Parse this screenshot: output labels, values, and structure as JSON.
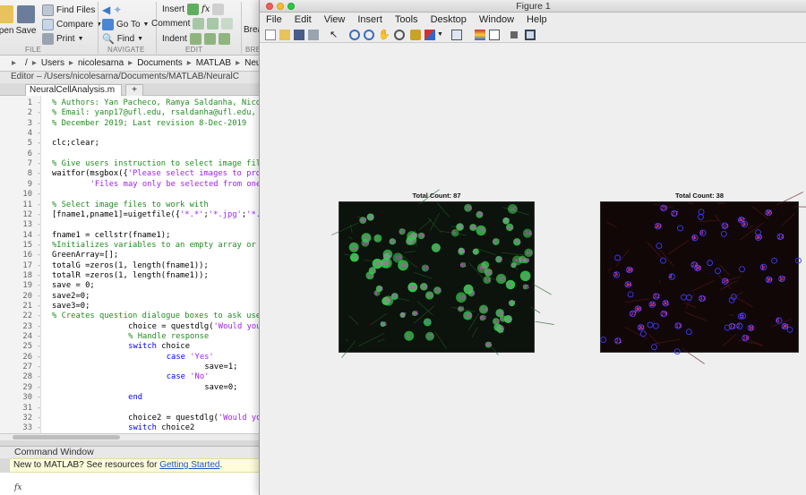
{
  "toolstrip": {
    "open_label": "Open",
    "save_label": "Save",
    "find_files_label": "Find Files",
    "compare_label": "Compare",
    "print_label": "Print",
    "go_to_label": "Go To",
    "find_label": "Find",
    "insert_label": "Insert",
    "comment_label": "Comment",
    "indent_label": "Indent",
    "breakpoints_label": "Brea",
    "sections": [
      "FILE",
      "NAVIGATE",
      "EDIT",
      "BREAK"
    ]
  },
  "address": {
    "segments": [
      "/",
      "Users",
      "nicolesarna",
      "Documents",
      "MATLAB",
      "NeuralC"
    ]
  },
  "editor": {
    "title": "Editor – /Users/nicolesarna/Documents/MATLAB/NeuralC",
    "active_tab": "NeuralCellAnalysis.m",
    "add_tab": "+",
    "lines": [
      {
        "n": "1",
        "d": "-",
        "segs": [
          {
            "t": "    % Authors: Yan Pacheco, Ramya Saldanha, Nico",
            "c": "com"
          }
        ]
      },
      {
        "n": "2",
        "d": "-",
        "segs": [
          {
            "t": "    % Email: yanp17@ufl.edu, rsaldanha@ufl.edu,",
            "c": "com"
          }
        ]
      },
      {
        "n": "3",
        "d": "-",
        "segs": [
          {
            "t": "    % December 2019; Last revision 8-Dec-2019",
            "c": "com"
          }
        ]
      },
      {
        "n": "4",
        "d": "-",
        "segs": []
      },
      {
        "n": "5",
        "d": "-",
        "segs": [
          {
            "t": "    clc;clear;",
            "c": ""
          }
        ]
      },
      {
        "n": "6",
        "d": "-",
        "segs": []
      },
      {
        "n": "7",
        "d": "-",
        "segs": [
          {
            "t": "    % Give users instruction to select image fil",
            "c": "com"
          }
        ]
      },
      {
        "n": "8",
        "d": "-",
        "segs": [
          {
            "t": "    waitfor(msgbox({",
            "c": ""
          },
          {
            "t": "'Please select images to pro",
            "c": "str"
          }
        ]
      },
      {
        "n": "9",
        "d": "-",
        "segs": [
          {
            "t": "        ",
            "c": ""
          },
          {
            "t": "'Files may only be selected from one dir",
            "c": "str"
          }
        ]
      },
      {
        "n": "10",
        "d": "-",
        "segs": []
      },
      {
        "n": "11",
        "d": "-",
        "segs": [
          {
            "t": "    % Select image files to work with",
            "c": "com"
          }
        ]
      },
      {
        "n": "12",
        "d": "-",
        "segs": [
          {
            "t": "    [fname1,pname1]=uigetfile({",
            "c": ""
          },
          {
            "t": "'*.*'",
            "c": "str"
          },
          {
            "t": ";",
            "c": ""
          },
          {
            "t": "'*.jpg'",
            "c": "str"
          },
          {
            "t": ";",
            "c": ""
          },
          {
            "t": "'*.",
            "c": "str"
          }
        ]
      },
      {
        "n": "13",
        "d": "-",
        "segs": []
      },
      {
        "n": "14",
        "d": "-",
        "segs": [
          {
            "t": "    fname1 = cellstr(fname1);",
            "c": ""
          }
        ]
      },
      {
        "n": "15",
        "d": "-",
        "segs": [
          {
            "t": "    %Initializes variables to an empty array or",
            "c": "com"
          }
        ]
      },
      {
        "n": "16",
        "d": "-",
        "segs": [
          {
            "t": "    GreenArray=[];",
            "c": ""
          }
        ]
      },
      {
        "n": "17",
        "d": "-",
        "segs": [
          {
            "t": "    totalG =zeros(1, length(fname1));",
            "c": ""
          }
        ]
      },
      {
        "n": "18",
        "d": "-",
        "segs": [
          {
            "t": "    totalR =zeros(1, length(fname1));",
            "c": ""
          }
        ]
      },
      {
        "n": "19",
        "d": "-",
        "segs": [
          {
            "t": "    save = 0;",
            "c": ""
          }
        ]
      },
      {
        "n": "20",
        "d": "-",
        "segs": [
          {
            "t": "    save2=0;",
            "c": ""
          }
        ]
      },
      {
        "n": "21",
        "d": "-",
        "segs": [
          {
            "t": "    save3=0;",
            "c": ""
          }
        ]
      },
      {
        "n": "22",
        "d": "-",
        "segs": [
          {
            "t": "    % Creates question dialogue boxes to ask use",
            "c": "com"
          }
        ]
      },
      {
        "n": "23",
        "d": "-",
        "segs": [
          {
            "t": "            choice = questdlg(",
            "c": ""
          },
          {
            "t": "'Would you like to",
            "c": "str"
          }
        ]
      },
      {
        "n": "24",
        "d": "-",
        "segs": [
          {
            "t": "            % Handle response",
            "c": "com"
          }
        ]
      },
      {
        "n": "25",
        "d": "-",
        "segs": [
          {
            "t": "            ",
            "c": ""
          },
          {
            "t": "switch",
            "c": "key"
          },
          {
            "t": " choice",
            "c": ""
          }
        ]
      },
      {
        "n": "26",
        "d": "-",
        "segs": [
          {
            "t": "                ",
            "c": ""
          },
          {
            "t": "case",
            "c": "key"
          },
          {
            "t": " ",
            "c": ""
          },
          {
            "t": "'Yes'",
            "c": "str"
          }
        ]
      },
      {
        "n": "27",
        "d": "-",
        "segs": [
          {
            "t": "                    save=1;",
            "c": ""
          }
        ]
      },
      {
        "n": "28",
        "d": "-",
        "segs": [
          {
            "t": "                ",
            "c": ""
          },
          {
            "t": "case",
            "c": "key"
          },
          {
            "t": " ",
            "c": ""
          },
          {
            "t": "'No'",
            "c": "str"
          }
        ]
      },
      {
        "n": "29",
        "d": "-",
        "segs": [
          {
            "t": "                    save=0;",
            "c": ""
          }
        ]
      },
      {
        "n": "30",
        "d": "-",
        "segs": [
          {
            "t": "            ",
            "c": ""
          },
          {
            "t": "end",
            "c": "key"
          }
        ]
      },
      {
        "n": "31",
        "d": "-",
        "segs": []
      },
      {
        "n": "32",
        "d": "-",
        "segs": [
          {
            "t": "            choice2 = questdlg(",
            "c": ""
          },
          {
            "t": "'Would you like t",
            "c": "str"
          }
        ]
      },
      {
        "n": "33",
        "d": "-",
        "segs": [
          {
            "t": "            ",
            "c": ""
          },
          {
            "t": "switch",
            "c": "key"
          },
          {
            "t": " choice2",
            "c": ""
          }
        ]
      }
    ]
  },
  "command_window": {
    "header": "Command Window",
    "banner_text": "New to MATLAB? See resources for ",
    "banner_link": "Getting Started",
    "banner_end": ".",
    "prompt_icon": "fx"
  },
  "figure": {
    "window_title": "Figure 1",
    "menus": [
      "File",
      "Edit",
      "View",
      "Insert",
      "Tools",
      "Desktop",
      "Window",
      "Help"
    ],
    "toolbar_icons": [
      "new-figure-icon",
      "open-file-icon",
      "save-figure-icon",
      "print-figure-icon",
      "pointer-icon",
      "zoom-in-icon",
      "zoom-out-icon",
      "pan-icon",
      "rotate-3d-icon",
      "data-cursor-icon",
      "brush-icon",
      "link-plot-icon",
      "colorbar-icon",
      "legend-icon",
      "hide-plot-tools-icon",
      "show-plot-tools-icon"
    ],
    "left_axes": {
      "title": "Total Count: 87",
      "label_numbers": [
        "20",
        "8",
        "23",
        "28",
        "45",
        "66",
        "47",
        "36",
        "65",
        "64",
        "22",
        "56",
        "62",
        "58",
        "32",
        "34",
        "44",
        "79",
        "54",
        "14",
        "53",
        "80",
        "30",
        "63",
        "15",
        "37",
        "11",
        "50",
        "59",
        "26",
        "76",
        "3",
        "10",
        "40",
        "82",
        "81",
        "35",
        "18",
        "29",
        "41",
        "71",
        "24",
        "43",
        "70",
        "83",
        "1",
        "12",
        "2",
        "17",
        "55",
        "27",
        "16",
        "7",
        "51",
        "60",
        "48",
        "69",
        "25",
        "52",
        "68",
        "61",
        "46",
        "13",
        "9",
        "33",
        "86",
        "42",
        "21",
        "6",
        "31",
        "49",
        "87",
        "77",
        "78",
        "39",
        "73",
        "5",
        "4",
        "72",
        "38",
        "67",
        "19",
        "57",
        "85",
        "84",
        "74",
        "75"
      ]
    },
    "right_axes": {
      "title": "Total Count: 38",
      "label_numbers": [
        "6",
        "35",
        "37",
        "16",
        "36",
        "5",
        "13",
        "18",
        "2",
        "22",
        "19",
        "11",
        "12",
        "3",
        "31",
        "38",
        "42",
        "15",
        "33",
        "14",
        "21",
        "28",
        "27",
        "17",
        "24",
        "10",
        "30",
        "32",
        "23",
        "9",
        "4",
        "20",
        "29",
        "26",
        "8",
        "34",
        "7",
        "1"
      ]
    },
    "colors": {
      "label_magenta": "#e040e0",
      "circle_blue": "#3a3aff",
      "green_cells": "#35d04a",
      "red_cells": "#c83030"
    }
  }
}
